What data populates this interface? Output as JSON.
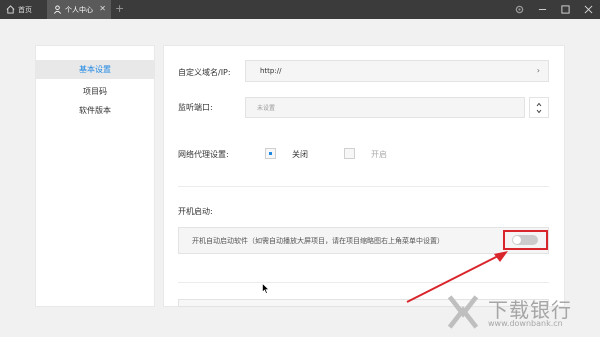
{
  "tabs": {
    "home": "首页",
    "user": "个人中心"
  },
  "sidebar": {
    "items": [
      {
        "label": "基本设置"
      },
      {
        "label": "项目码"
      },
      {
        "label": "软件版本"
      }
    ]
  },
  "settings": {
    "domain_label": "自定义域名/IP:",
    "domain_value": "http://",
    "port_label": "监听端口:",
    "port_value": "未设置",
    "proxy_label": "网络代理设置:",
    "proxy_off": "关闭",
    "proxy_on": "开启",
    "startup_section": "开机启动:",
    "startup_desc": "开机自动启动软件（如需自动播放大屏项目，请在项目缩略图右上角菜单中设置）"
  },
  "watermark": {
    "brand": "下载银行",
    "url": "www.downbank.cn"
  },
  "colors": {
    "accent": "#1e88e5",
    "highlight": "#d9262c",
    "titlebar": "#3b3b3b"
  }
}
